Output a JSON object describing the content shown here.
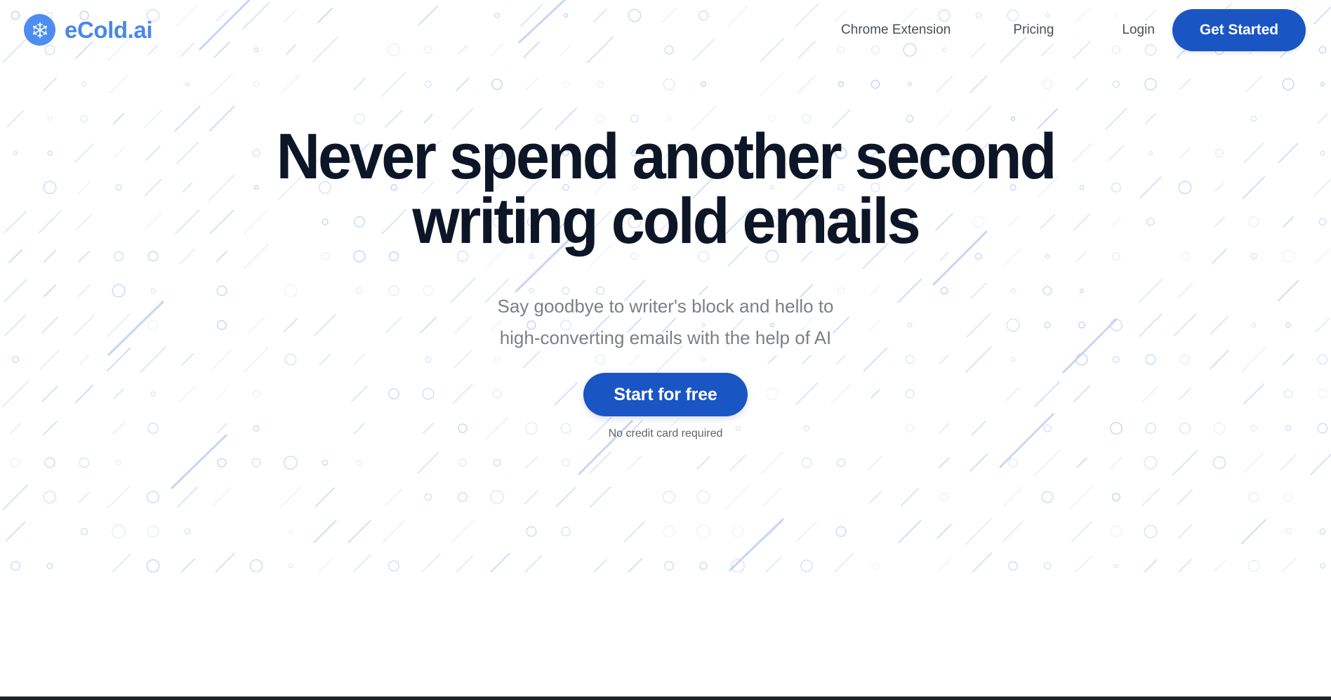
{
  "brand": {
    "name": "eCold.ai",
    "icon": "snowflake-icon",
    "mark_color": "#4d8cf0",
    "text_color": "#4a86ea"
  },
  "nav": {
    "links": [
      {
        "label": "Chrome Extension"
      },
      {
        "label": "Pricing"
      },
      {
        "label": "Login"
      }
    ],
    "cta": {
      "label": "Get Started",
      "bg_color": "#1a55c4",
      "text_color": "#ffffff"
    }
  },
  "hero": {
    "title_line1": "Never spend another second",
    "title_line2": "writing cold emails",
    "title_color": "#0d1627",
    "subtitle_line1": "Say goodbye to writer's block and hello to",
    "subtitle_line2": "high-converting emails with the help of AI",
    "subtitle_color": "#7b7f86",
    "cta": {
      "label": "Start for free",
      "bg_color": "#1a55c4",
      "text_color": "#ffffff"
    },
    "note": "No credit card required"
  },
  "background": {
    "pattern": "diagonal-slashes-and-circles",
    "pattern_color": "#c3d4f5",
    "grid_spacing": 49
  },
  "footer_rule_color": "#1e232b"
}
